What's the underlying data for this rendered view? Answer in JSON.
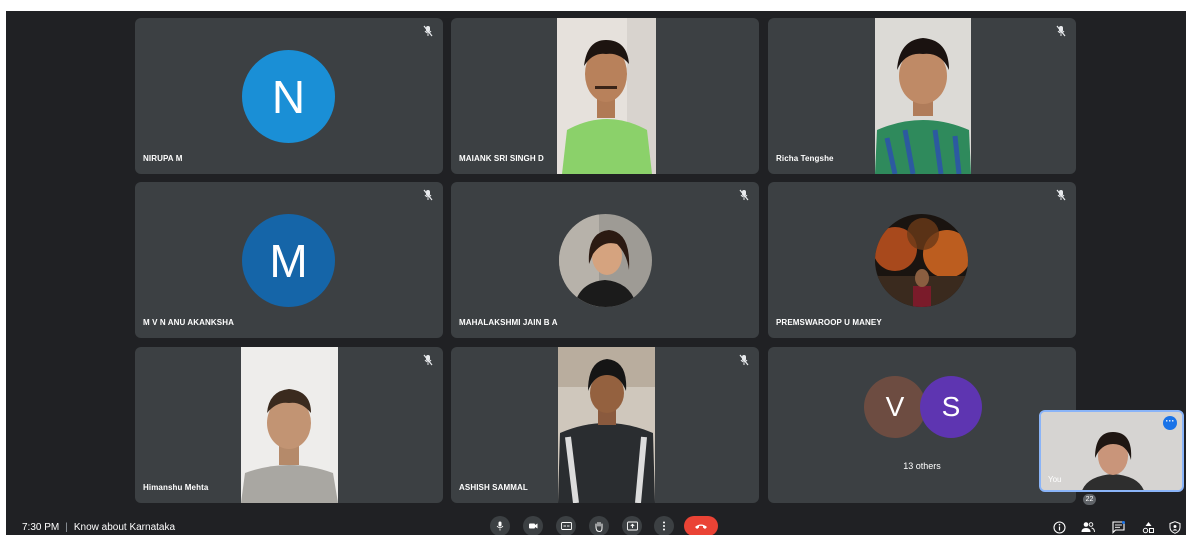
{
  "participants": [
    {
      "name": "NIRUPA M",
      "avatar_letter": "N",
      "avatar_color": "#1a8fd6",
      "muted": true
    },
    {
      "name": "MAIANK SRI SINGH D",
      "has_video": true,
      "muted": false
    },
    {
      "name": "Richa Tengshe",
      "has_video": true,
      "muted": true
    },
    {
      "name": "M V N ANU AKANKSHA",
      "avatar_letter": "M",
      "avatar_color": "#1565a8",
      "muted": true
    },
    {
      "name": "MAHALAKSHMI JAIN B A",
      "has_profile_photo": true,
      "muted": true
    },
    {
      "name": "PREMSWAROOP U MANEY",
      "has_profile_photo": true,
      "muted": true
    },
    {
      "name": "Himanshu Mehta",
      "has_video": true,
      "muted": true
    },
    {
      "name": "ASHISH SAMMAL",
      "has_video": true,
      "muted": true
    }
  ],
  "others_tile": {
    "avatars": [
      {
        "letter": "V",
        "color": "#6d4c41"
      },
      {
        "letter": "S",
        "color": "#5e35b1"
      }
    ],
    "label": "13 others"
  },
  "self_view": {
    "name": "You"
  },
  "meeting": {
    "time": "7:30 PM",
    "title": "Know about Karnataka"
  },
  "controls": [
    "mic-icon",
    "camera-icon",
    "captions-icon",
    "raise-hand-icon",
    "present-icon",
    "more-options-icon",
    "end-call-icon"
  ],
  "people_count": "22",
  "colors": {
    "background": "#202124",
    "tile": "#3c4043",
    "end_call": "#ea4335",
    "accent": "#1a73e8"
  }
}
